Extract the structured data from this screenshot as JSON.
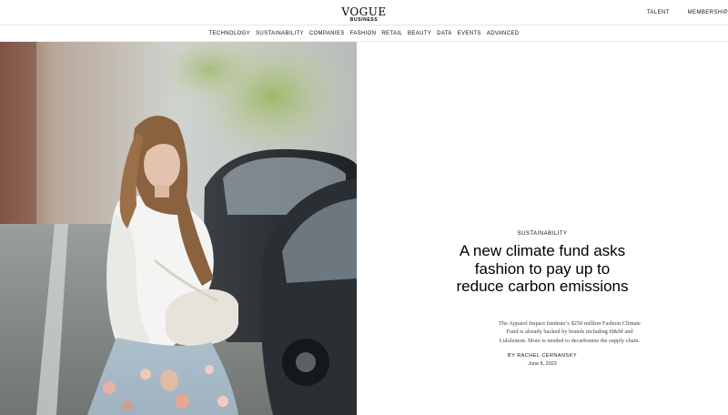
{
  "brand": {
    "logo_main": "VOGUE",
    "logo_sub": "BUSINESS"
  },
  "top_links": [
    "TALENT",
    "MEMBERSHIP"
  ],
  "nav": [
    "TECHNOLOGY",
    "SUSTAINABILITY",
    "COMPANIES",
    "FASHION",
    "RETAIL",
    "BEAUTY",
    "DATA",
    "EVENTS",
    "ADVANCED"
  ],
  "article": {
    "kicker": "SUSTAINABILITY",
    "headline": "A new climate fund asks fashion to pay up to reduce carbon emissions",
    "dek": "The Apparel Impact Institute’s $250 million Fashion Climate Fund is already backed by brands including H&M and Lululemon. More is needed to decarbonise the supply chain.",
    "byline": "BY RACHEL CERNANSKY",
    "date": "June 8, 2022"
  },
  "colors": {
    "accent": "#000000",
    "divider": "#e6e6e6"
  }
}
